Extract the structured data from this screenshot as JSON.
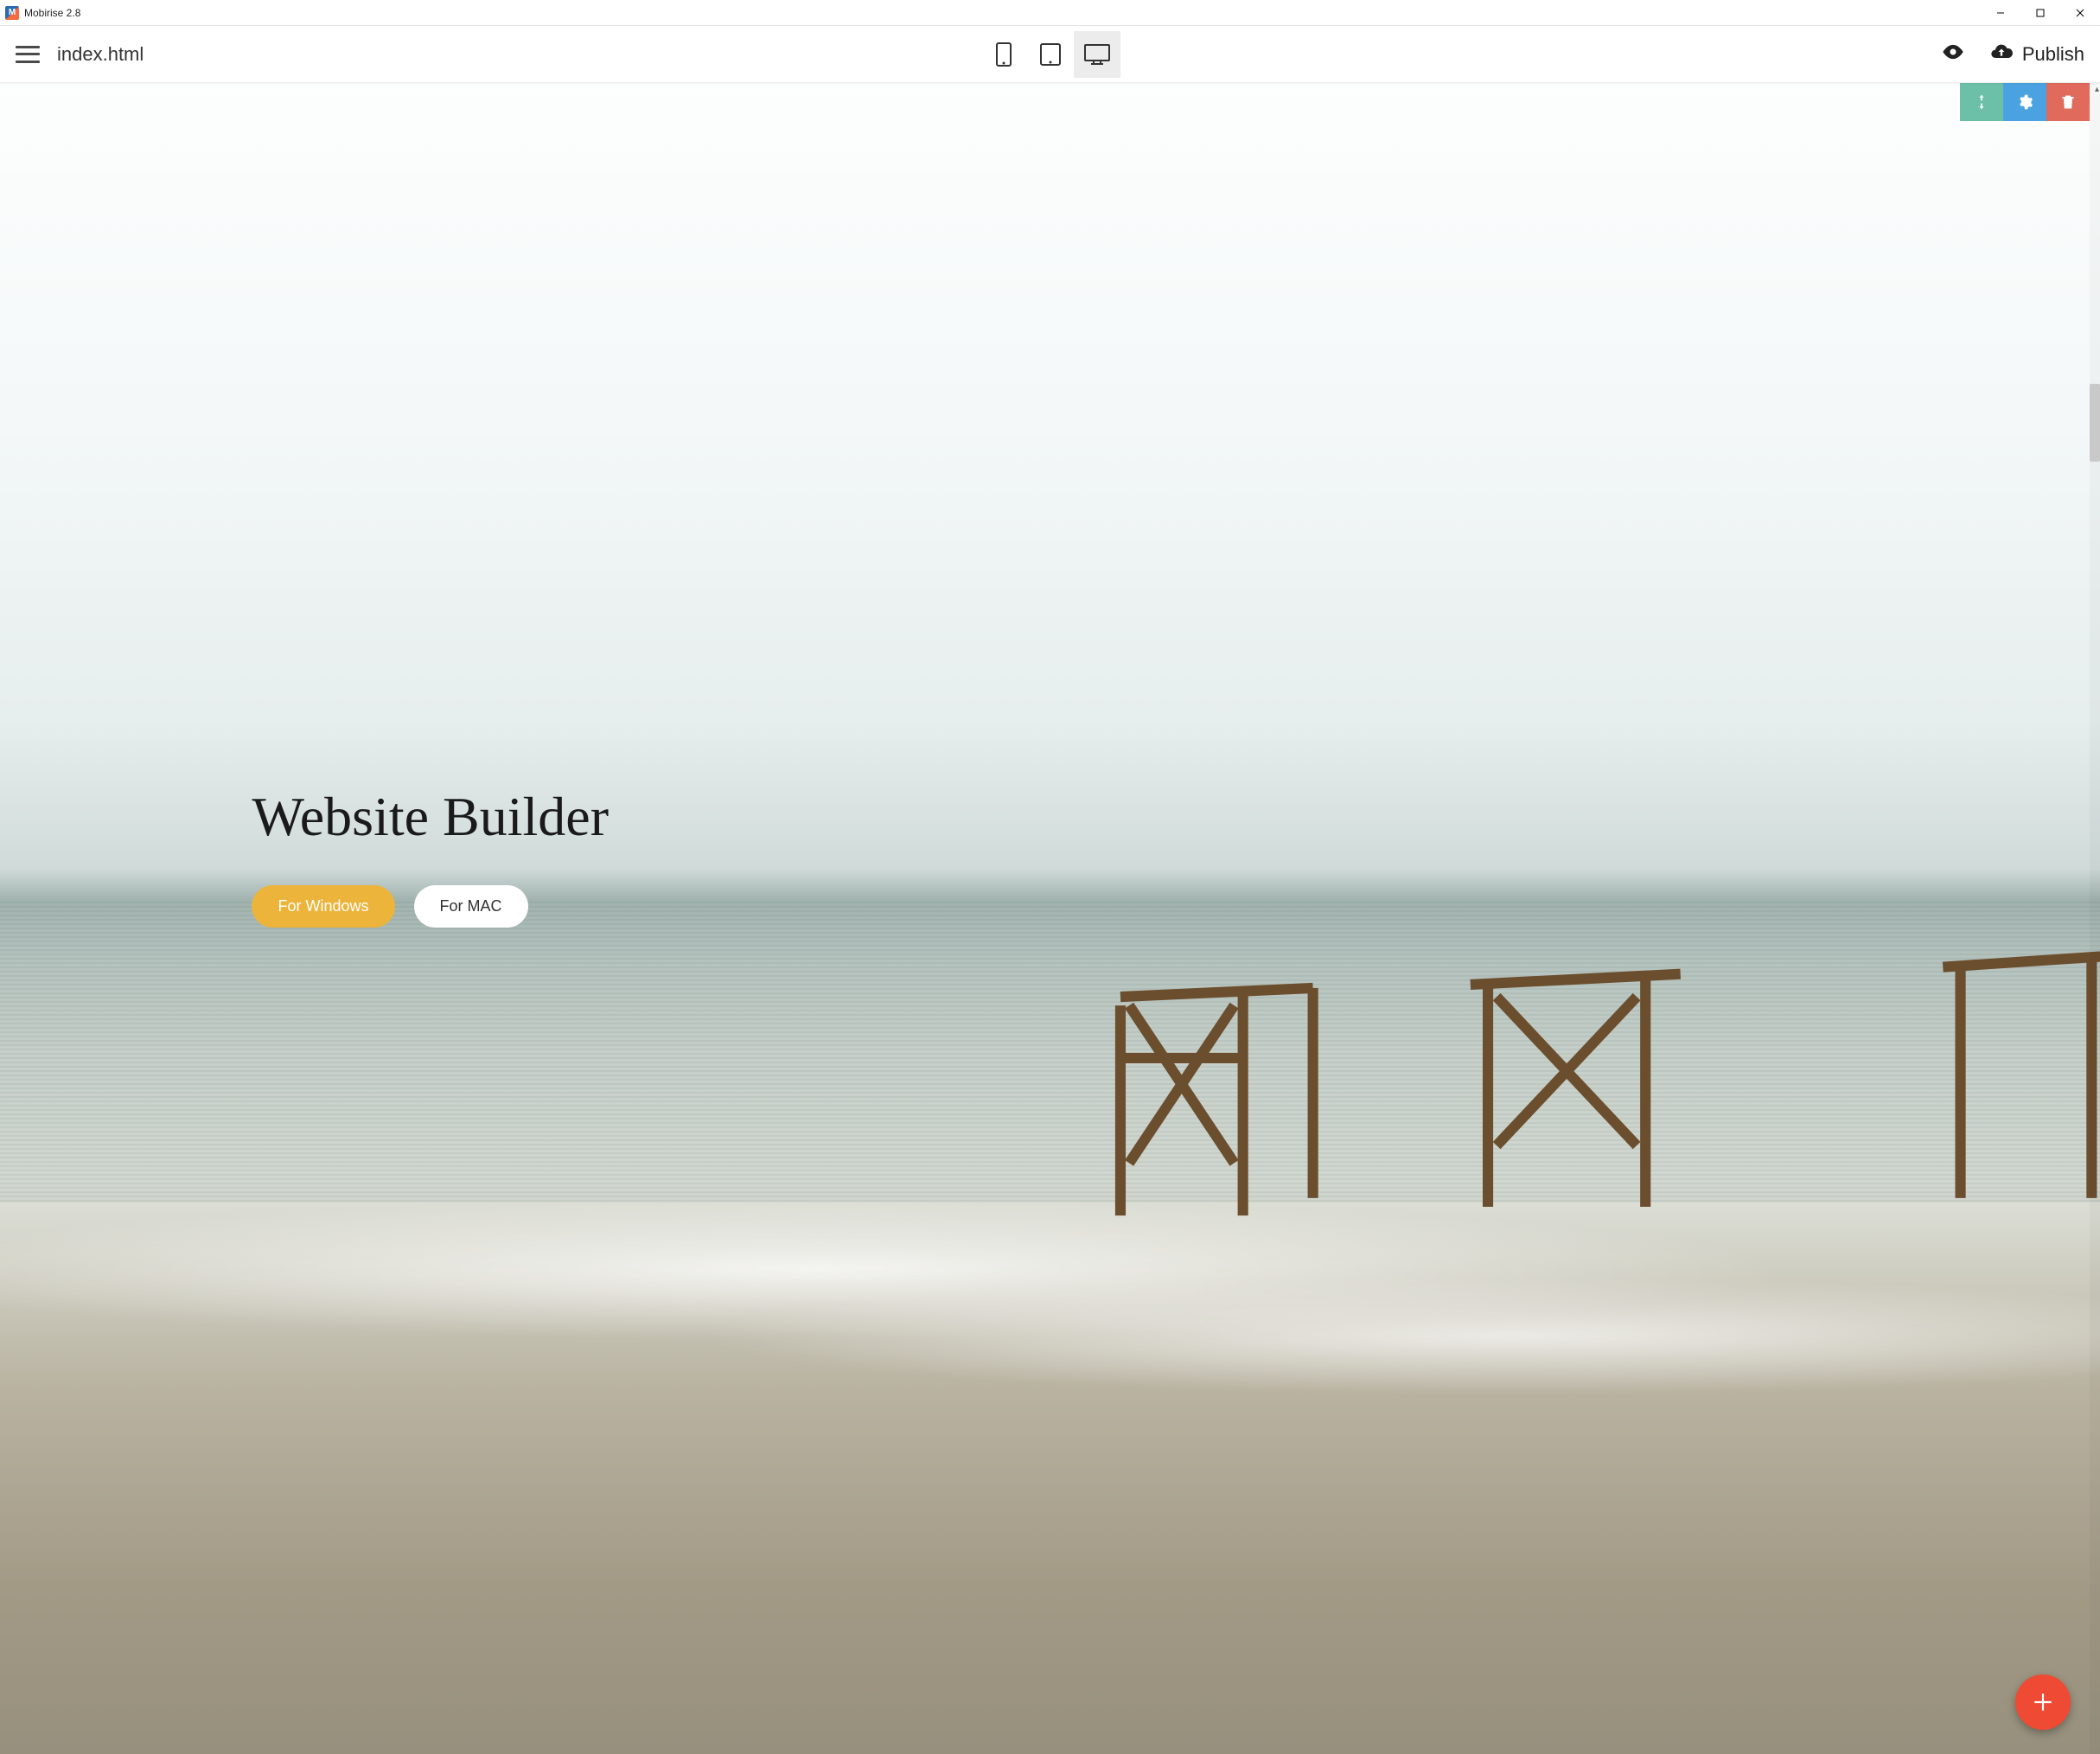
{
  "window": {
    "title": "Mobirise 2.8"
  },
  "toolbar": {
    "page_name": "index.html",
    "devices": {
      "mobile": {
        "name": "mobile-view",
        "active": false
      },
      "tablet": {
        "name": "tablet-view",
        "active": false
      },
      "desktop": {
        "name": "desktop-view",
        "active": true
      }
    },
    "preview_icon": "eye-icon",
    "publish_label": "Publish",
    "publish_icon": "cloud-upload-icon"
  },
  "hero": {
    "title": "Website Builder",
    "buttons": {
      "primary": {
        "label": "For Windows",
        "color": "#ecb43a"
      },
      "secondary": {
        "label": "For MAC",
        "color": "#ffffff"
      }
    }
  },
  "block_tools": {
    "move": {
      "icon": "move-vertical-icon",
      "color": "#6cc0a8"
    },
    "config": {
      "icon": "gear-icon",
      "color": "#4aa3e0"
    },
    "delete": {
      "icon": "trash-icon",
      "color": "#e06a5c"
    }
  },
  "fab": {
    "icon": "plus-icon",
    "color": "#ef4a33"
  }
}
